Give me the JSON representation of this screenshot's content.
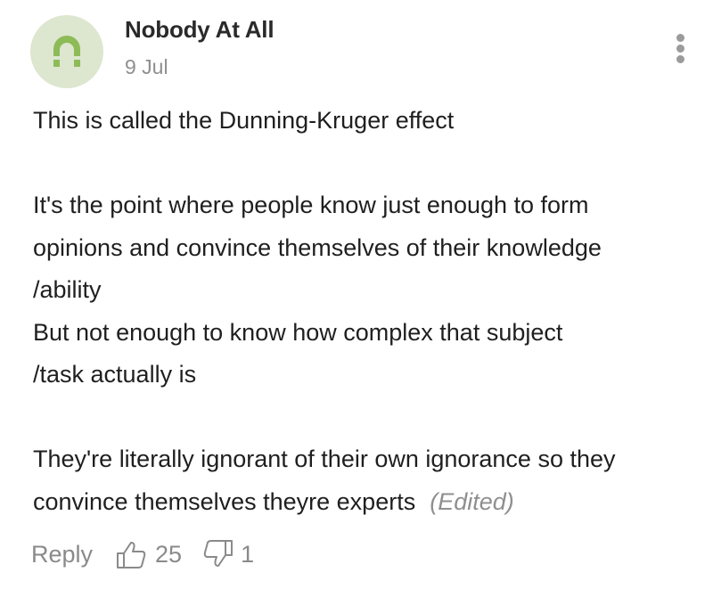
{
  "comment": {
    "author": "Nobody At All",
    "date": "9 Jul",
    "paragraphs": [
      [
        "This is called the Dunning-Kruger effect"
      ],
      [
        "It's the point where people know just enough to form",
        "opinions and convince themselves of their knowledge",
        "/ability",
        "But not enough to know how complex that subject",
        "/task actually is"
      ],
      [
        "They're literally ignorant of their own ignorance so they",
        "convince themselves theyre experts"
      ]
    ],
    "edited_label": "(Edited)",
    "reply_label": "Reply",
    "likes": "25",
    "dislikes": "1"
  },
  "colors": {
    "avatar_bg": "#dde6cf",
    "avatar_fg": "#8dbb57",
    "muted": "#8f8f8f"
  },
  "icons": {
    "avatar": "user-avatar-icon",
    "more": "more-options-icon",
    "like": "thumbs-up-icon",
    "dislike": "thumbs-down-icon"
  }
}
